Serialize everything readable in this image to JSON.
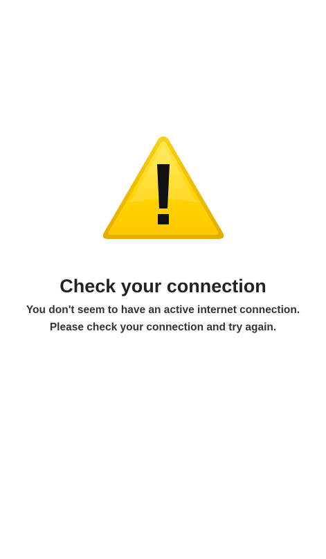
{
  "error_page": {
    "icon": "warning-triangle-icon",
    "title": "Check your connection",
    "message_line1": "You don't seem to have an active internet connection.",
    "message_line2": "Please check your connection and try again."
  },
  "colors": {
    "background": "#ffffff",
    "warning_yellow": "#ffd400",
    "warning_edge": "#e8b800",
    "exclamation": "#111111",
    "title_text": "#222222",
    "message_text": "#333333"
  }
}
